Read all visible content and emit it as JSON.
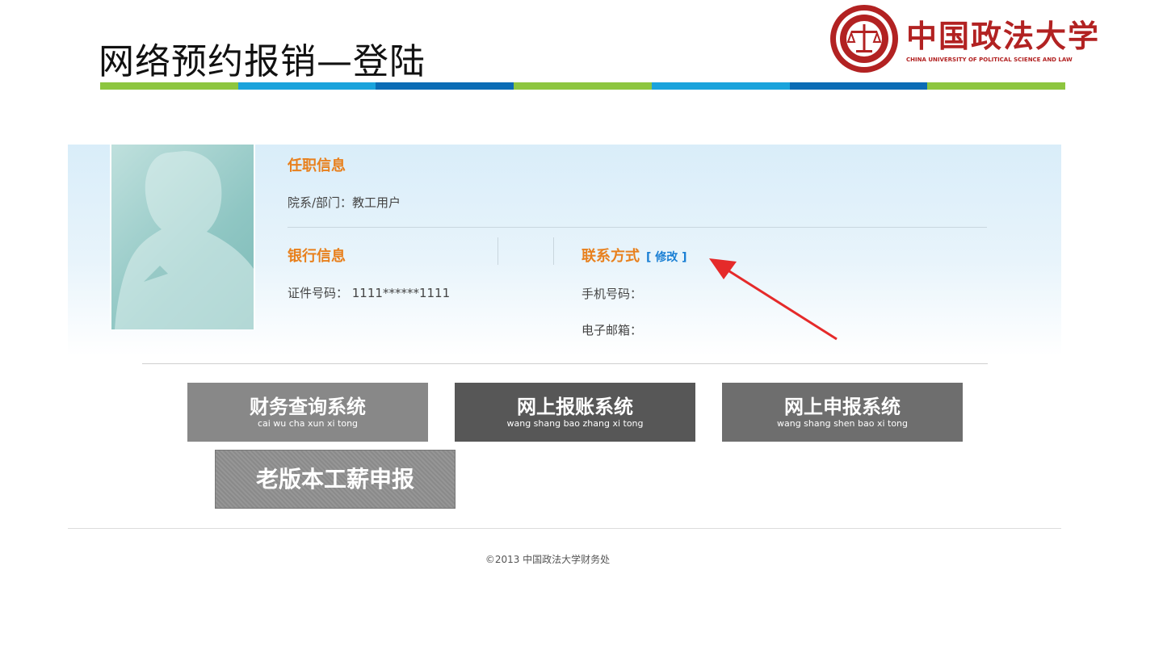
{
  "slide": {
    "title": "网络预约报销—登陆"
  },
  "logo": {
    "name_cn": "中国政法大学",
    "name_en": "CHINA UNIVERSITY OF POLITICAL SCIENCE AND LAW"
  },
  "stripe_colors": [
    "#8dc63f",
    "#1aa3dc",
    "#0b6cb5",
    "#8dc63f",
    "#1aa3dc",
    "#0b6cb5",
    "#8dc63f"
  ],
  "profile": {
    "job_info": {
      "title": "任职信息",
      "department": "院系/部门：教工用户"
    },
    "bank_info": {
      "title": "银行信息",
      "id_number": "证件号码：  1111******1111"
    },
    "contact": {
      "title": "联系方式",
      "edit_label": "[ 修改 ]",
      "phone": "手机号码：",
      "email": "电子邮箱："
    }
  },
  "systems": [
    {
      "cn": "财务查询系统",
      "py": "cai wu cha xun xi tong",
      "bg": "#888888"
    },
    {
      "cn": "网上报账系统",
      "py": "wang shang bao zhang xi tong",
      "bg": "#575757"
    },
    {
      "cn": "网上申报系统",
      "py": "wang shang shen bao xi tong",
      "bg": "#6e6e6e"
    }
  ],
  "old_system": {
    "cn": "老版本工薪申报"
  },
  "footer": {
    "text": "©2013 中国政法大学财务处"
  },
  "colors": {
    "accent_orange": "#e8801d",
    "link_blue": "#1a7fd4",
    "arrow_red": "#e52a2a",
    "logo_red": "#b22222"
  }
}
